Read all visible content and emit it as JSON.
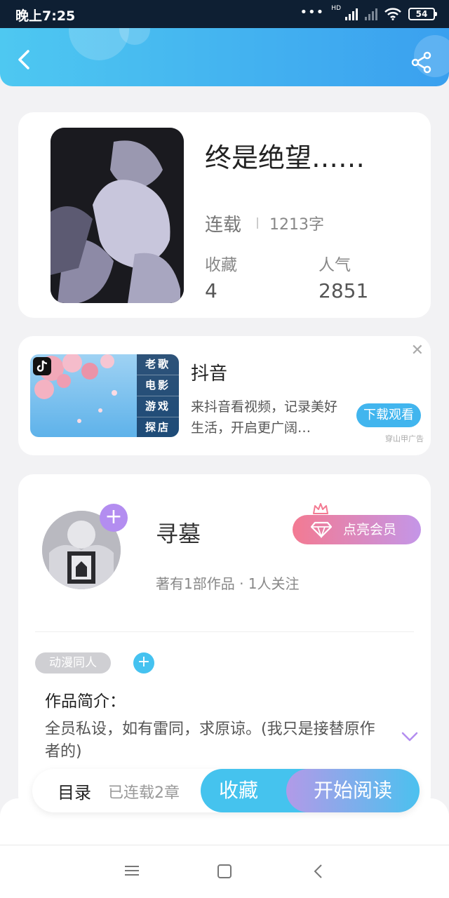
{
  "status_bar": {
    "time": "晚上7:25",
    "hd": "HD",
    "battery": "54"
  },
  "book": {
    "title": "终是绝望……",
    "status": "连载",
    "word_count": "1213字",
    "favorites_label": "收藏",
    "favorites_value": "4",
    "popularity_label": "人气",
    "popularity_value": "2851"
  },
  "ad": {
    "name": "抖音",
    "description": "来抖音看视频，记录美好生活，开启更广阔…",
    "button": "下载观看",
    "source": "穿山甲广告",
    "menu_items": [
      "老歌",
      "电影",
      "游戏",
      "探店"
    ]
  },
  "author": {
    "name": "寻墓",
    "vip_button": "点亮会员",
    "meta": "著有1部作品 · 1人关注",
    "tag": "动漫同人",
    "intro_label": "作品简介：",
    "intro_text": "全员私设，如有雷同，求原谅。(我只是接替原作者的)"
  },
  "action_bar": {
    "toc": "目录",
    "chapters": "已连载2章",
    "collect": "收藏",
    "read": "开始阅读"
  },
  "colors": {
    "accent_blue": "#45c3ee",
    "accent_purple": "#b38df0",
    "vip_pink": "#f37a92"
  },
  "icons": [
    "back-arrow-icon",
    "share-icon",
    "close-icon",
    "tiktok-logo-icon",
    "plus-icon",
    "crown-icon",
    "diamond-icon",
    "chevron-down-icon",
    "nav-menu-icon",
    "nav-home-icon",
    "nav-back-icon"
  ]
}
